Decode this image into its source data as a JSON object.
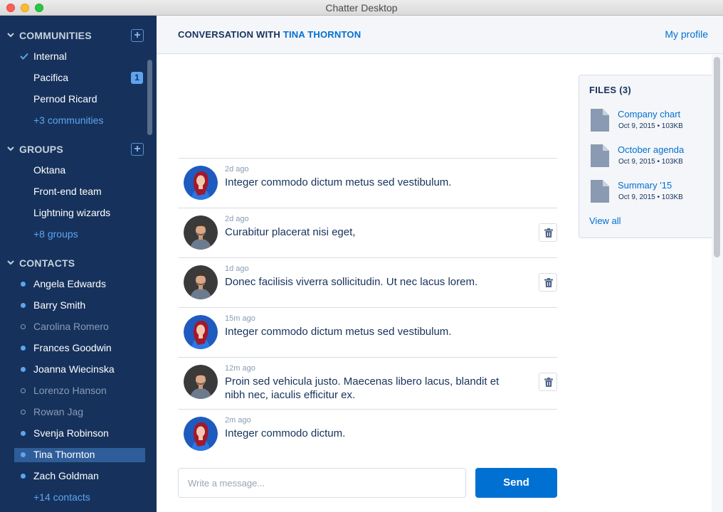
{
  "window": {
    "title": "Chatter Desktop"
  },
  "sidebar": {
    "communities": {
      "title": "COMMUNITIES",
      "add": "+",
      "items": [
        {
          "label": "Internal",
          "checked": true
        },
        {
          "label": "Pacifica",
          "badge": "1"
        },
        {
          "label": "Pernod Ricard"
        }
      ],
      "more": "+3 communities"
    },
    "groups": {
      "title": "GROUPS",
      "add": "+",
      "items": [
        {
          "label": "Oktana"
        },
        {
          "label": "Front-end team"
        },
        {
          "label": "Lightning wizards"
        }
      ],
      "more": "+8 groups"
    },
    "contacts": {
      "title": "CONTACTS",
      "items": [
        {
          "label": "Angela Edwards",
          "status": "online"
        },
        {
          "label": "Barry Smith",
          "status": "online"
        },
        {
          "label": "Carolina Romero",
          "status": "offline"
        },
        {
          "label": "Frances Goodwin",
          "status": "online"
        },
        {
          "label": "Joanna Wiecinska",
          "status": "online"
        },
        {
          "label": "Lorenzo Hanson",
          "status": "offline"
        },
        {
          "label": "Rowan Jag",
          "status": "offline"
        },
        {
          "label": "Svenja Robinson",
          "status": "online"
        },
        {
          "label": "Tina Thornton",
          "status": "online",
          "selected": true
        },
        {
          "label": "Zach Goldman",
          "status": "online"
        }
      ],
      "more": "+14 contacts"
    }
  },
  "header": {
    "prefix": "CONVERSATION WITH",
    "contact": "TINA THORNTON",
    "my_profile": "My profile"
  },
  "messages": [
    {
      "time": "2d ago",
      "text": "Integer commodo dictum metus sed vestibulum.",
      "author": "Tina Thornton",
      "deletable": false
    },
    {
      "time": "2d ago",
      "text": "Curabitur placerat nisi eget,",
      "author": "me",
      "deletable": true
    },
    {
      "time": "1d ago",
      "text": "Donec facilisis viverra sollicitudin. Ut nec lacus lorem.",
      "author": "me",
      "deletable": true
    },
    {
      "time": "15m ago",
      "text": "Integer commodo dictum metus sed vestibulum.",
      "author": "Tina Thornton",
      "deletable": false
    },
    {
      "time": "12m ago",
      "text": "Proin sed vehicula justo. Maecenas libero lacus, blandit et nibh nec, iaculis efficitur ex.",
      "author": "me",
      "deletable": true
    },
    {
      "time": "2m ago",
      "text": "Integer commodo dictum.",
      "author": "Tina Thornton",
      "deletable": false
    }
  ],
  "composer": {
    "placeholder": "Write a message...",
    "send_label": "Send"
  },
  "files": {
    "title": "FILES (3)",
    "items": [
      {
        "name": "Company chart",
        "meta": "Oct 9, 2015 • 103KB"
      },
      {
        "name": "October agenda",
        "meta": "Oct 9, 2015 • 103KB"
      },
      {
        "name": "Summary '15",
        "meta": "Oct 9, 2015 • 103KB"
      }
    ],
    "view_all": "View all"
  },
  "colors": {
    "sidebar": "#16325c",
    "accent": "#0070d2",
    "selected": "#2f5d99",
    "link_light": "#5ea4f0"
  }
}
